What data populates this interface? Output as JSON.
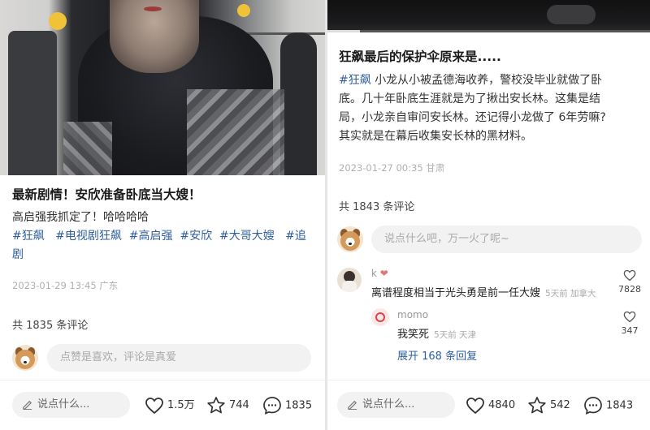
{
  "left": {
    "title": "最新剧情！安欣准备卧底当大嫂！",
    "text": "高启强我抓定了！哈哈哈哈",
    "tags": [
      "#狂飙",
      "#电视剧狂飙",
      "#高启强",
      "#安欣",
      "#大哥大嫂",
      "#追剧"
    ],
    "meta": "2023-01-29 13:45 广东",
    "comment_count": "共 1835 条评论",
    "comment_placeholder": "点赞是喜欢，评论是真爱",
    "bottom": {
      "say": "说点什么...",
      "likes": "1.5万",
      "stars": "744",
      "comments": "1835"
    }
  },
  "right": {
    "video_progress": 0.1,
    "title": "狂飙最后的保护伞原来是.....",
    "tag": "#狂飙",
    "text_line1": "小龙从小被孟德海收养，警校没毕业就做了卧",
    "text_line2": "底。几十年卧底生涯就是为了揪出安长林。这集是结",
    "text_line3": "局，小龙亲自审问安长林。还记得小龙做了 6年劳嘛?",
    "text_line4": "其实就是在幕后收集安长林的黑材料。",
    "meta": "2023-01-27 00:35 甘肃",
    "comment_count": "共 1843 条评论",
    "comment_placeholder": "说点什么吧，万一火了呢~",
    "comments": [
      {
        "name": "k",
        "text": "离谱程度相当于光头勇是前一任大嫂",
        "time": "5天前 加拿大",
        "likes": "7828"
      },
      {
        "name": "momo",
        "text": "我笑死",
        "time": "5天前 天津",
        "likes": "347"
      }
    ],
    "expand": "展开 168 条回复",
    "bottom": {
      "say": "说点什么...",
      "likes": "4840",
      "stars": "542",
      "comments": "1843"
    }
  },
  "icons": {
    "pencil": "pencil-icon",
    "heart": "heart-icon",
    "star": "star-icon",
    "comment": "comment-icon"
  },
  "colors": {
    "tag": "#2e5e9e",
    "meta": "#b0b0b0"
  }
}
